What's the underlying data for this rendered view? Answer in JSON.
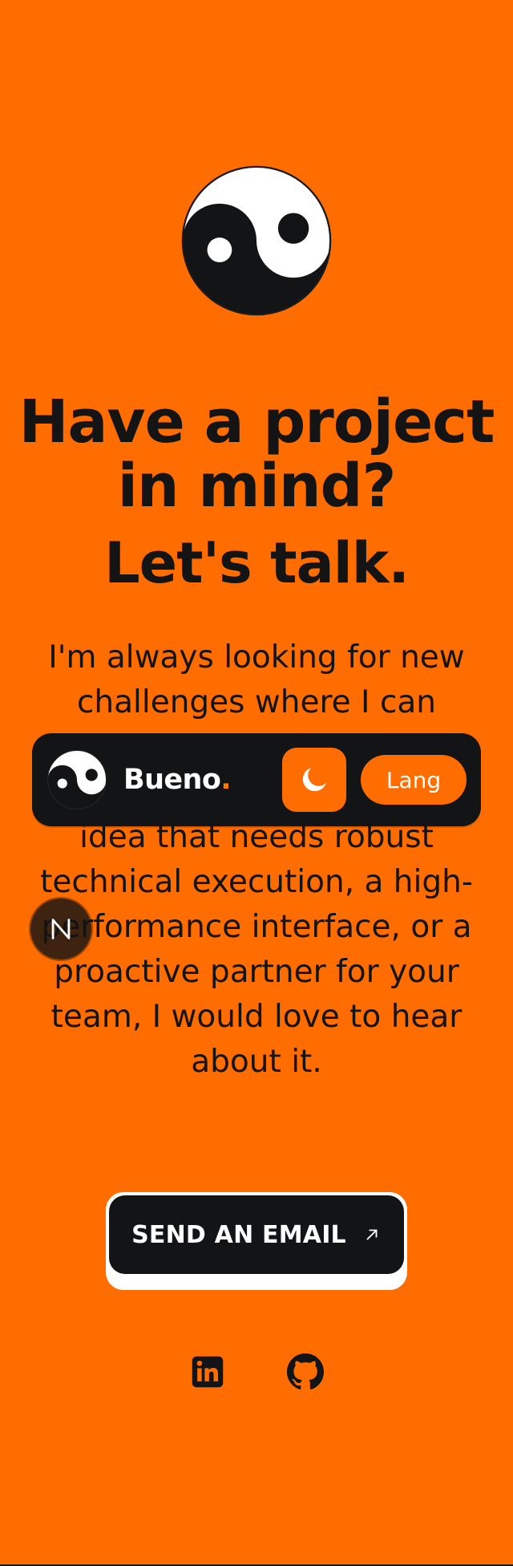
{
  "headline": "Have a project in mind?",
  "subheadline": "Let's talk.",
  "intro": "I'm always looking for new challenges where I can contribute to software engineering. If you have an idea that needs robust technical execution, a high-performance interface, or a proactive partner for your team, I would love to hear about it.",
  "cta": {
    "label": "SEND AN EMAIL",
    "icon": "arrow-up-right-icon"
  },
  "social": [
    {
      "icon": "linkedin-icon"
    },
    {
      "icon": "github-icon"
    }
  ],
  "navbar": {
    "brand_name": "Bueno",
    "brand_dot": ".",
    "theme_toggle_icon": "moon-icon",
    "language_label": "Lang"
  },
  "devtools_indicator_label": "N",
  "colors": {
    "page_background": "#ff6d00",
    "ink": "#141414",
    "navbar_background": "#131416",
    "accent": "#ff6d00",
    "button_text": "#ffffff"
  }
}
